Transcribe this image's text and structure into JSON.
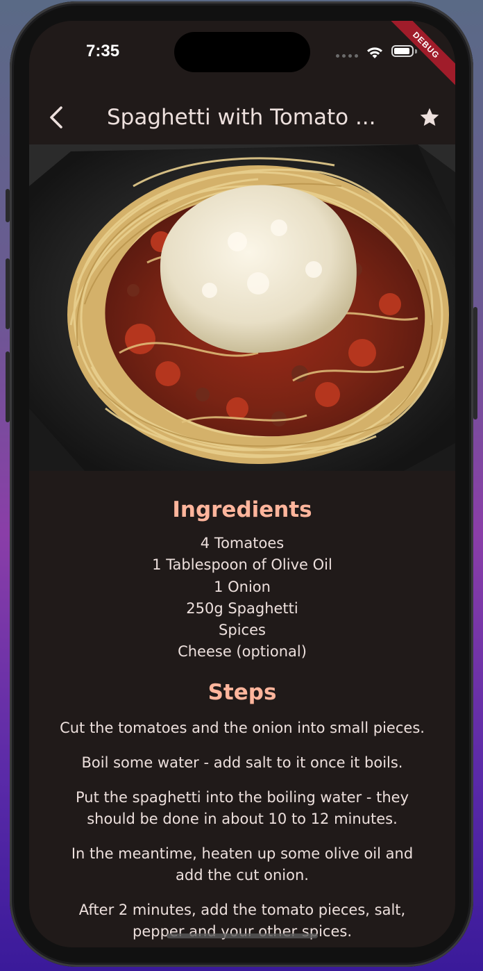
{
  "status_bar": {
    "time": "7:35",
    "debug_label": "DEBUG"
  },
  "app_bar": {
    "title": "Spaghetti with Tomato ...",
    "back_icon": "chevron-left-icon",
    "favorite_icon": "star-icon"
  },
  "hero_image": {
    "description_icon": "dish-photo"
  },
  "ingredients": {
    "title": "Ingredients",
    "items": [
      "4 Tomatoes",
      "1 Tablespoon of Olive Oil",
      "1 Onion",
      "250g Spaghetti",
      "Spices",
      "Cheese (optional)"
    ]
  },
  "steps": {
    "title": "Steps",
    "items": [
      "Cut the tomatoes and the onion into small pieces.",
      "Boil some water - add salt to it once it boils.",
      "Put the spaghetti into the boiling water - they should be done in about 10 to 12 minutes.",
      "In the meantime, heaten up some olive oil and add the cut onion.",
      "After 2 minutes, add the tomato pieces, salt, pepper and your other spices."
    ]
  },
  "colors": {
    "background": "#201a19",
    "accent": "#ffb59c",
    "text": "#ede0dd",
    "debug_ribbon": "#a01c2a"
  }
}
